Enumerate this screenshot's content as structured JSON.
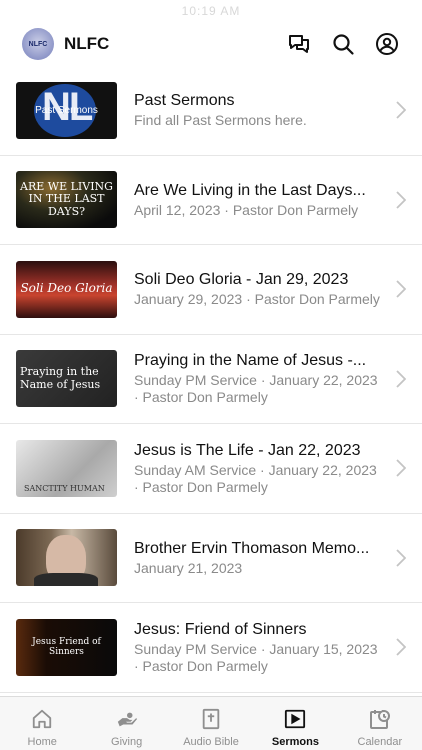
{
  "status_bar": {
    "time": "10:19 AM"
  },
  "header": {
    "app_title": "NLFC",
    "logo_text": "NLFC"
  },
  "sermons": [
    {
      "title": "Past Sermons",
      "subtitle": "Find all Past Sermons here.",
      "thumb_text": "Past Sermons"
    },
    {
      "title": "Are We Living in the Last Days...",
      "subtitle": "April 12, 2023 · Pastor Don Parmely",
      "thumb_text": "ARE WE LIVING IN THE LAST DAYS?"
    },
    {
      "title": "Soli Deo Gloria - Jan 29, 2023",
      "subtitle": "January 29, 2023 · Pastor Don Parmely",
      "thumb_text": "Soli Deo Gloria"
    },
    {
      "title": "Praying in the Name of Jesus -...",
      "subtitle": "Sunday PM Service · January 22, 2023 · Pastor Don Parmely",
      "thumb_text": "Praying in the Name of Jesus"
    },
    {
      "title": "Jesus is The Life - Jan 22, 2023",
      "subtitle": "Sunday AM Service · January 22, 2023 · Pastor Don Parmely",
      "thumb_text": "SANCTITY HUMAN"
    },
    {
      "title": "Brother Ervin Thomason Memo...",
      "subtitle": "January 21, 2023",
      "thumb_text": ""
    },
    {
      "title": "Jesus: Friend of Sinners",
      "subtitle": "Sunday PM Service · January 15, 2023 · Pastor Don Parmely",
      "thumb_text": "Jesus Friend of Sinners"
    }
  ],
  "tabs": [
    {
      "label": "Home",
      "icon": "home-icon"
    },
    {
      "label": "Giving",
      "icon": "giving-icon"
    },
    {
      "label": "Audio Bible",
      "icon": "bible-icon"
    },
    {
      "label": "Sermons",
      "icon": "play-icon"
    },
    {
      "label": "Calendar",
      "icon": "calendar-icon"
    }
  ],
  "active_tab": "Sermons",
  "colors": {
    "text": "#111111",
    "subtext": "#8a8a8a",
    "divider": "#e6e6e6",
    "tabbar_bg": "#f7f7f7"
  }
}
